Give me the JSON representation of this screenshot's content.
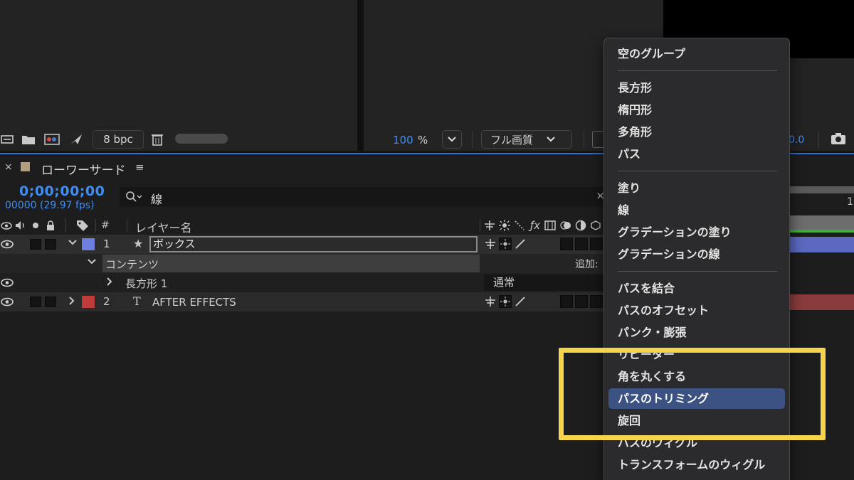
{
  "viewer_left": {
    "bpc_label": "8 bpc"
  },
  "viewer": {
    "zoom": "100",
    "zoom_unit": "%",
    "quality": "フル画質",
    "exposure": "0.0"
  },
  "timeline": {
    "close": "×",
    "title": "ローワーサード",
    "menu": "≡",
    "timecode": "0;00;00;00",
    "frames": "00000 (29.97 fps)",
    "search_value": "線",
    "search_clear": "×",
    "header_hash": "#",
    "header_name": "レイヤー名",
    "ruler_num": "1"
  },
  "layers": [
    {
      "num": "1",
      "type_icon": "★",
      "name": "ボックス",
      "color": "#6f7fe0"
    },
    {
      "num": "2",
      "type_icon": "T",
      "name": "AFTER EFFECTS",
      "color": "#c23b3b"
    }
  ],
  "contents": {
    "label": "コンテンツ",
    "add_label": "追加:",
    "rect_label": "長方形 1",
    "blend_mode": "通常"
  },
  "menu": {
    "items": [
      "空のグループ",
      "長方形",
      "楕円形",
      "多角形",
      "パス",
      "塗り",
      "線",
      "グラデーションの塗り",
      "グラデーションの線",
      "パスを結合",
      "パスのオフセット",
      "パンク・膨張",
      "リピーター",
      "角を丸くする",
      "パスのトリミング",
      "旋回",
      "パスのウィグル",
      "トランスフォームのウィグル"
    ],
    "selected_index": 14
  },
  "colors": {
    "accent_blue": "#3e8df5",
    "menu_selected": "#3b5283",
    "highlight": "#f6d44c"
  }
}
